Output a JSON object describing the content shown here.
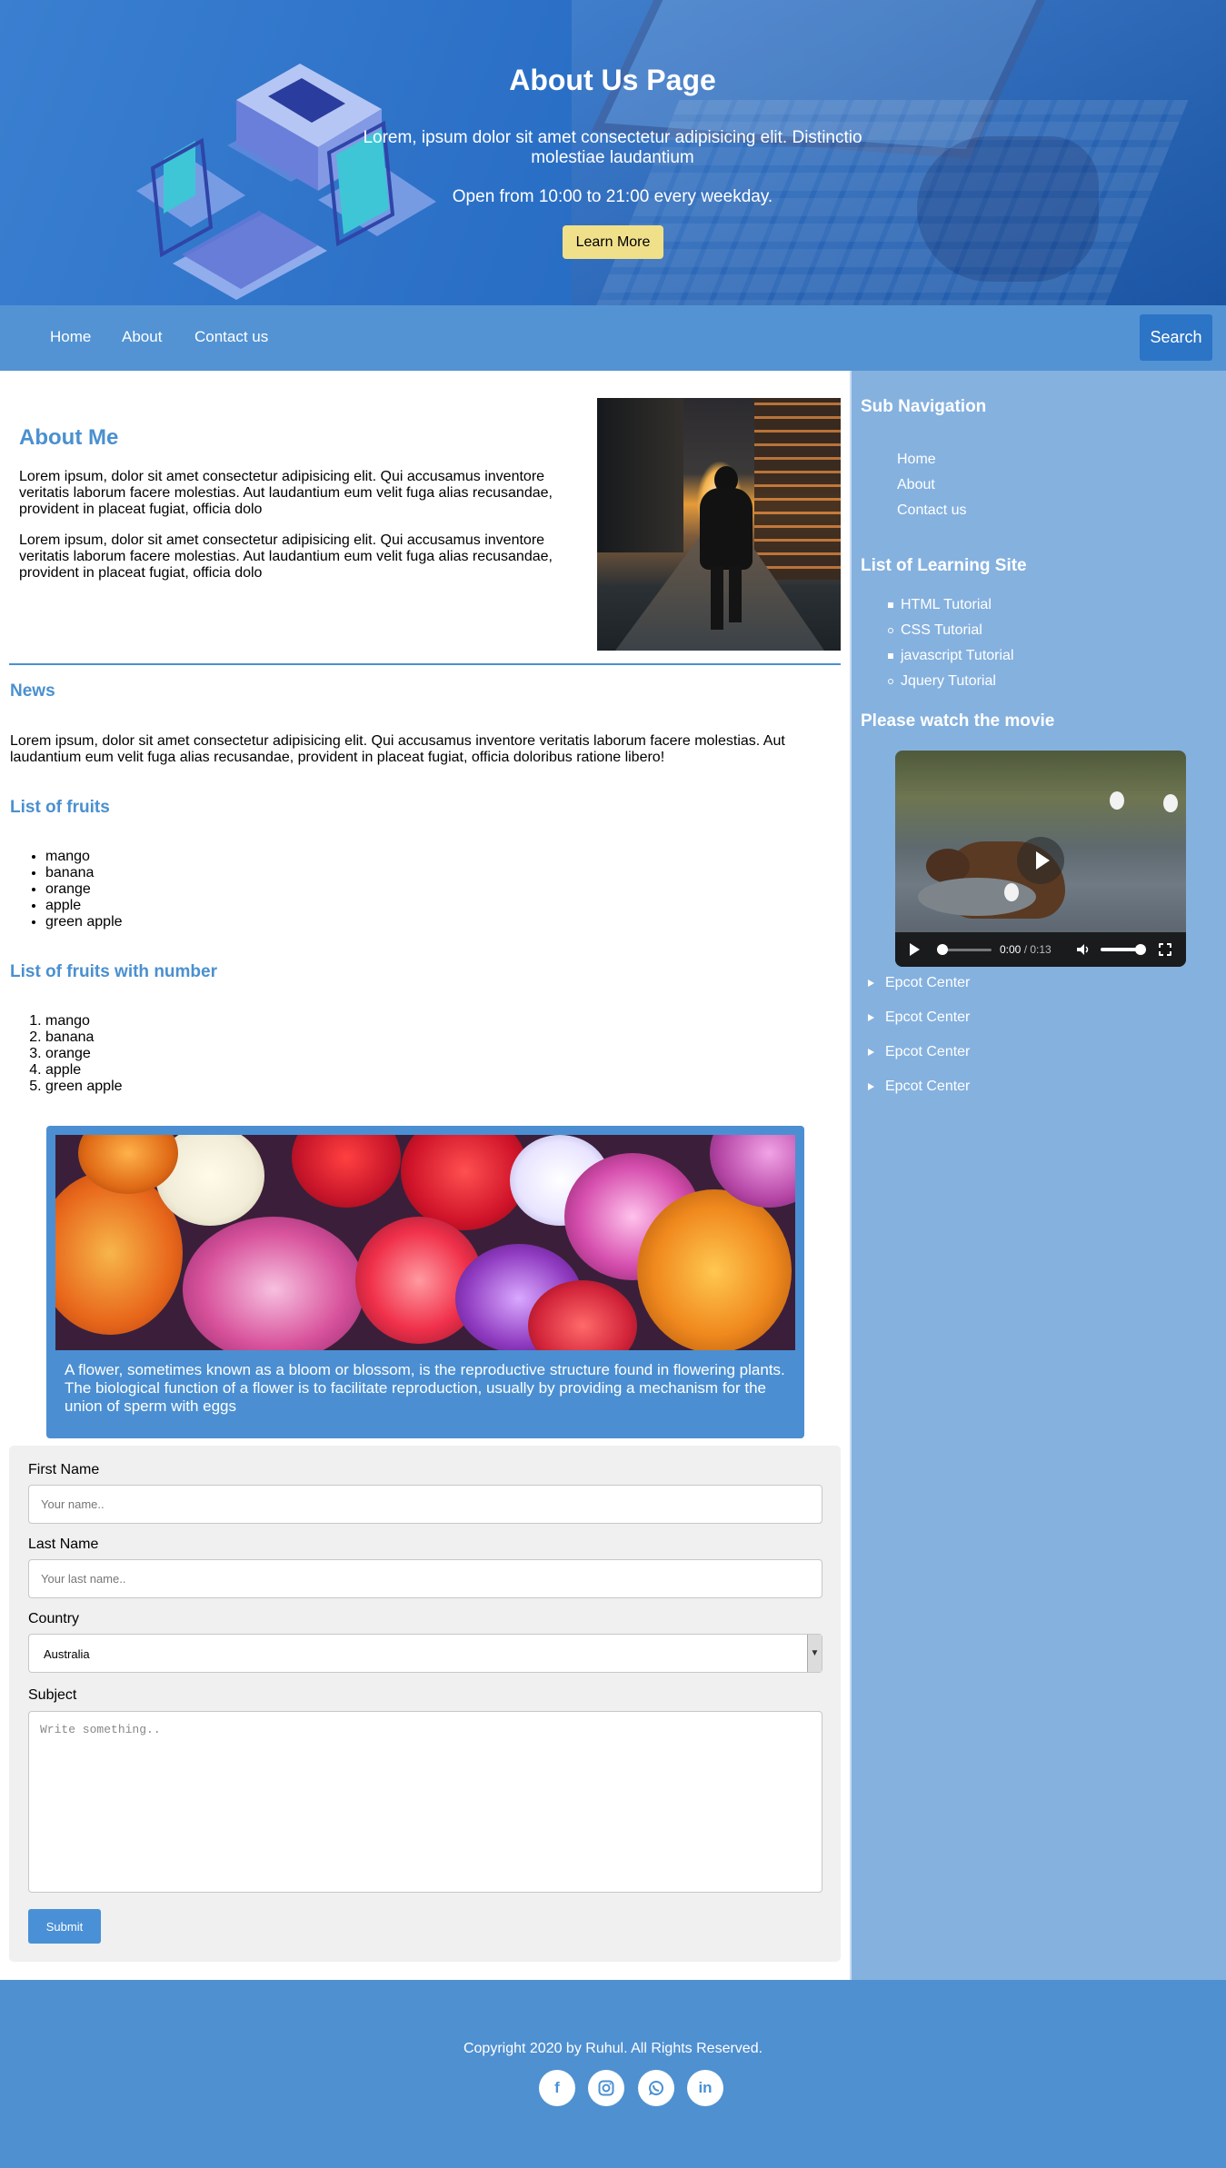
{
  "hero": {
    "title": "About Us Page",
    "description": "Lorem, ipsum dolor sit amet consectetur adipisicing elit. Distinctio molestiae laudantium",
    "hours": "Open from 10:00 to 21:00 every weekday.",
    "button_label": "Learn More"
  },
  "nav": {
    "items": [
      "Home",
      "About",
      "Contact us"
    ],
    "search_label": "Search"
  },
  "about": {
    "title": "About Me",
    "paragraphs": [
      "Lorem ipsum, dolor sit amet consectetur adipisicing elit. Qui accusamus inventore veritatis laborum facere molestias. Aut laudantium eum velit fuga alias recusandae, provident in placeat fugiat, officia dolo",
      "Lorem ipsum, dolor sit amet consectetur adipisicing elit. Qui accusamus inventore veritatis laborum facere molestias. Aut laudantium eum velit fuga alias recusandae, provident in placeat fugiat, officia dolo"
    ]
  },
  "news": {
    "title": "News",
    "text": "Lorem ipsum, dolor sit amet consectetur adipisicing elit. Qui accusamus inventore veritatis laborum facere molestias. Aut laudantium eum velit fuga alias recusandae, provident in placeat fugiat, officia doloribus ratione libero!"
  },
  "fruits": {
    "title": "List of fruits",
    "items": [
      "mango",
      "banana",
      "orange",
      "apple",
      "green apple"
    ]
  },
  "fruits_numbered": {
    "title": "List of fruits with number",
    "items": [
      "mango",
      "banana",
      "orange",
      "apple",
      "green apple"
    ]
  },
  "flower": {
    "caption": "A flower, sometimes known as a bloom or blossom, is the reproductive structure found in flowering plants. The biological function of a flower is to facilitate reproduction, usually by providing a mechanism for the union of sperm with eggs"
  },
  "form": {
    "first_name_label": "First Name",
    "first_name_placeholder": "Your name..",
    "last_name_label": "Last Name",
    "last_name_placeholder": "Your last name..",
    "country_label": "Country",
    "country_value": "Australia",
    "subject_label": "Subject",
    "subject_placeholder": "Write something..",
    "submit_label": "Submit"
  },
  "sidebar": {
    "sub_nav_title": "Sub Navigation",
    "sub_nav_items": [
      "Home",
      "About",
      "Contact us"
    ],
    "learning_title": "List of Learning Site",
    "learning_items": [
      "HTML Tutorial",
      "CSS Tutorial",
      "javascript Tutorial",
      "Jquery Tutorial"
    ],
    "movie_title": "Please watch the movie",
    "video_time": "0:00",
    "video_duration": "/ 0:13",
    "details_items": [
      "Epcot Center",
      "Epcot Center",
      "Epcot Center",
      "Epcot Center"
    ]
  },
  "footer": {
    "copyright": "Copyright 2020 by Ruhul. All Rights Reserved.",
    "social_icons": [
      "facebook-icon",
      "instagram-icon",
      "whatsapp-icon",
      "linkedin-icon"
    ]
  },
  "colors": {
    "accent": "#4a90d0",
    "nav": "#5393d3",
    "sidebar": "#85b1df",
    "hero_button": "#f0e08a"
  }
}
